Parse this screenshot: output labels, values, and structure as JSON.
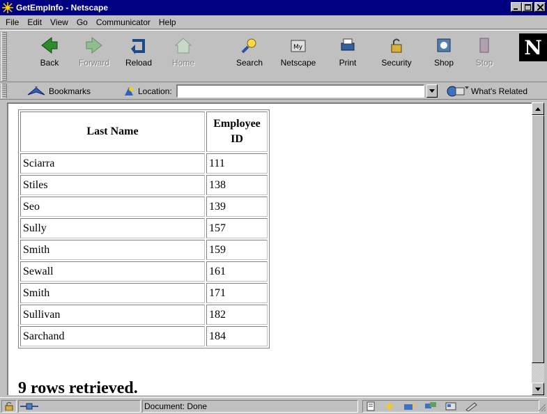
{
  "window": {
    "title": "GetEmpInfo - Netscape"
  },
  "menu": [
    "File",
    "Edit",
    "View",
    "Go",
    "Communicator",
    "Help"
  ],
  "toolbar": {
    "buttons": [
      {
        "label": "Back",
        "icon": "back-arrow-icon",
        "enabled": true
      },
      {
        "label": "Forward",
        "icon": "forward-arrow-icon",
        "enabled": false
      },
      {
        "label": "Reload",
        "icon": "reload-icon",
        "enabled": true
      },
      {
        "label": "Home",
        "icon": "home-icon",
        "enabled": false
      },
      {
        "label": "Search",
        "icon": "search-icon",
        "enabled": true
      },
      {
        "label": "Netscape",
        "icon": "my-netscape-icon",
        "enabled": true
      },
      {
        "label": "Print",
        "icon": "print-icon",
        "enabled": true
      },
      {
        "label": "Security",
        "icon": "security-lock-icon",
        "enabled": true
      },
      {
        "label": "Shop",
        "icon": "shop-icon",
        "enabled": true
      },
      {
        "label": "Stop",
        "icon": "stop-icon",
        "enabled": false
      }
    ],
    "logo": "N"
  },
  "locationbar": {
    "bookmarks_label": "Bookmarks",
    "location_label": "Location:",
    "url": "",
    "related_label": "What's Related"
  },
  "table": {
    "headers": [
      "Last Name",
      "Employee ID"
    ],
    "rows": [
      [
        "Sciarra",
        "111"
      ],
      [
        "Stiles",
        "138"
      ],
      [
        "Seo",
        "139"
      ],
      [
        "Sully",
        "157"
      ],
      [
        "Smith",
        "159"
      ],
      [
        "Sewall",
        "161"
      ],
      [
        "Smith",
        "171"
      ],
      [
        "Sullivan",
        "182"
      ],
      [
        "Sarchand",
        "184"
      ]
    ]
  },
  "result_text": "9 rows retrieved.",
  "status": {
    "text": "Document: Done"
  },
  "colors": {
    "titlebar": "#000080",
    "chrome": "#c0c0c0"
  }
}
